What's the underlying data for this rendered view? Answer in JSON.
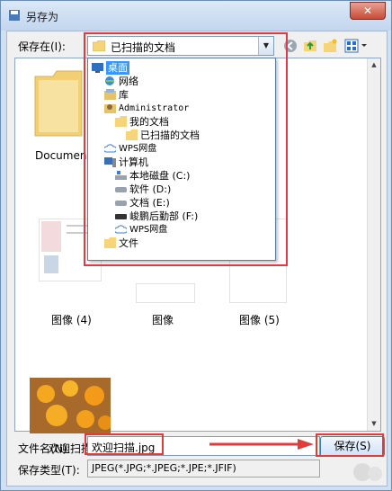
{
  "window": {
    "title": "另存为",
    "close_label": "✕"
  },
  "toolbar": {
    "save_in_label": "保存在(I):",
    "save_in_value": "已扫描的文档"
  },
  "browser": {
    "items": [
      {
        "label": "Documen"
      },
      {
        "label": "图像 (4)"
      },
      {
        "label": "图像"
      },
      {
        "label": "图像 (5)"
      },
      {
        "label": "欢迎扫描"
      }
    ]
  },
  "dropdown": {
    "items": [
      {
        "label": "桌面",
        "icon": "desktop-icon",
        "selected": true
      },
      {
        "label": "网络",
        "icon": "network-icon"
      },
      {
        "label": "库",
        "icon": "library-icon"
      },
      {
        "label": "Administrator",
        "icon": "user-icon"
      },
      {
        "label": "我的文档",
        "icon": "folder-icon"
      },
      {
        "label": "已扫描的文档",
        "icon": "folder-icon"
      },
      {
        "label": "WPS网盘",
        "icon": "cloud-icon"
      },
      {
        "label": "计算机",
        "icon": "computer-icon"
      },
      {
        "label": "本地磁盘 (C:)",
        "icon": "drive-icon"
      },
      {
        "label": "软件 (D:)",
        "icon": "drive-icon"
      },
      {
        "label": "文档 (E:)",
        "icon": "drive-icon"
      },
      {
        "label": "峻鹏后勤部 (F:)",
        "icon": "drive-icon"
      },
      {
        "label": "WPS网盘",
        "icon": "cloud-icon"
      },
      {
        "label": "文件",
        "icon": "folder-icon"
      }
    ]
  },
  "footer": {
    "filename_label": "文件名(N):",
    "filename_value": "欢迎扫描.jpg",
    "save_button": "保存(S)",
    "type_label": "保存类型(T):",
    "type_value": "JPEG(*.JPG;*.JPEG;*.JPE;*.JFIF)"
  },
  "colors": {
    "highlight": "#3399ff",
    "annotation": "#e03c3c",
    "folder": "#f5d47a"
  }
}
